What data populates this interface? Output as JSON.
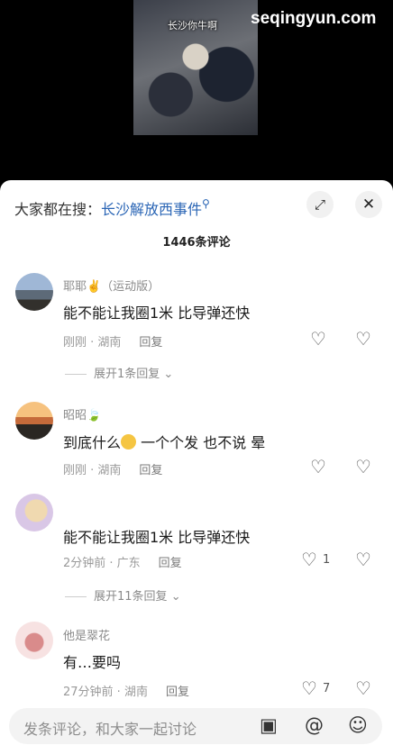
{
  "video": {
    "caption": "长沙你牛啊"
  },
  "watermark": "seqingyun.com",
  "sheet": {
    "search_prefix": "大家都在搜：",
    "search_keyword": "长沙解放西事件",
    "expand_icon": "expand-icon",
    "close_icon": "close-icon",
    "count": "1446条评论"
  },
  "comments": [
    {
      "name": "耶耶✌️（运动版）",
      "text": "能不能让我圈1米 比导弹还快",
      "time": "刚刚 · 湖南",
      "reply": "回复",
      "likes": "",
      "expand": "展开1条回复"
    },
    {
      "name": "昭昭🍃",
      "text_a": "到底什么",
      "text_b": "一个个发 也不说 晕",
      "time": "刚刚 · 湖南",
      "reply": "回复",
      "likes": ""
    },
    {
      "name": "",
      "text": "能不能让我圈1米 比导弹还快",
      "time": "2分钟前 · 广东",
      "reply": "回复",
      "likes": "1",
      "expand": "展开11条回复"
    },
    {
      "name": "他是翠花",
      "text": "有…要吗",
      "time": "27分钟前 · 湖南",
      "reply": "回复",
      "likes": "7"
    }
  ],
  "composer": {
    "placeholder": "发条评论，和大家一起讨论"
  },
  "icons": {
    "heart": "heart-icon",
    "dislike": "broken-heart-icon",
    "image": "image-icon",
    "at": "at-icon",
    "emoji": "emoji-icon"
  }
}
